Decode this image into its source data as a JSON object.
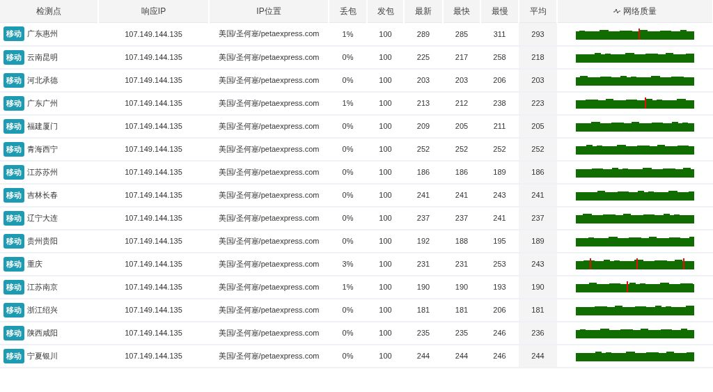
{
  "table": {
    "columns": [
      "检测点",
      "响应IP",
      "IP位置",
      "丢包",
      "发包",
      "最新",
      "最快",
      "最慢",
      "平均",
      "网络质量"
    ],
    "rows": [
      {
        "isp": "移动",
        "node": "广东惠州",
        "ip": "107.149.144.135",
        "location": "美国/圣何塞/petaexpress.com",
        "loss": "1%",
        "sent": "100",
        "latest": "289",
        "fastest": "285",
        "slowest": "311",
        "average": "293"
      },
      {
        "isp": "移动",
        "node": "云南昆明",
        "ip": "107.149.144.135",
        "location": "美国/圣何塞/petaexpress.com",
        "loss": "0%",
        "sent": "100",
        "latest": "225",
        "fastest": "217",
        "slowest": "258",
        "average": "218"
      },
      {
        "isp": "移动",
        "node": "河北承德",
        "ip": "107.149.144.135",
        "location": "美国/圣何塞/petaexpress.com",
        "loss": "0%",
        "sent": "100",
        "latest": "203",
        "fastest": "203",
        "slowest": "206",
        "average": "203"
      },
      {
        "isp": "移动",
        "node": "广东广州",
        "ip": "107.149.144.135",
        "location": "美国/圣何塞/petaexpress.com",
        "loss": "1%",
        "sent": "100",
        "latest": "213",
        "fastest": "212",
        "slowest": "238",
        "average": "223"
      },
      {
        "isp": "移动",
        "node": "福建厦门",
        "ip": "107.149.144.135",
        "location": "美国/圣何塞/petaexpress.com",
        "loss": "0%",
        "sent": "100",
        "latest": "209",
        "fastest": "205",
        "slowest": "211",
        "average": "205"
      },
      {
        "isp": "移动",
        "node": "青海西宁",
        "ip": "107.149.144.135",
        "location": "美国/圣何塞/petaexpress.com",
        "loss": "0%",
        "sent": "100",
        "latest": "252",
        "fastest": "252",
        "slowest": "252",
        "average": "252"
      },
      {
        "isp": "移动",
        "node": "江苏苏州",
        "ip": "107.149.144.135",
        "location": "美国/圣何塞/petaexpress.com",
        "loss": "0%",
        "sent": "100",
        "latest": "186",
        "fastest": "186",
        "slowest": "189",
        "average": "186"
      },
      {
        "isp": "移动",
        "node": "吉林长春",
        "ip": "107.149.144.135",
        "location": "美国/圣何塞/petaexpress.com",
        "loss": "0%",
        "sent": "100",
        "latest": "241",
        "fastest": "241",
        "slowest": "243",
        "average": "241"
      },
      {
        "isp": "移动",
        "node": "辽宁大连",
        "ip": "107.149.144.135",
        "location": "美国/圣何塞/petaexpress.com",
        "loss": "0%",
        "sent": "100",
        "latest": "237",
        "fastest": "237",
        "slowest": "241",
        "average": "237"
      },
      {
        "isp": "移动",
        "node": "贵州贵阳",
        "ip": "107.149.144.135",
        "location": "美国/圣何塞/petaexpress.com",
        "loss": "0%",
        "sent": "100",
        "latest": "192",
        "fastest": "188",
        "slowest": "195",
        "average": "189"
      },
      {
        "isp": "移动",
        "node": "重庆",
        "ip": "107.149.144.135",
        "location": "美国/圣何塞/petaexpress.com",
        "loss": "3%",
        "sent": "100",
        "latest": "231",
        "fastest": "231",
        "slowest": "253",
        "average": "243"
      },
      {
        "isp": "移动",
        "node": "江苏南京",
        "ip": "107.149.144.135",
        "location": "美国/圣何塞/petaexpress.com",
        "loss": "1%",
        "sent": "100",
        "latest": "190",
        "fastest": "190",
        "slowest": "193",
        "average": "190"
      },
      {
        "isp": "移动",
        "node": "浙江绍兴",
        "ip": "107.149.144.135",
        "location": "美国/圣何塞/petaexpress.com",
        "loss": "0%",
        "sent": "100",
        "latest": "181",
        "fastest": "181",
        "slowest": "206",
        "average": "181"
      },
      {
        "isp": "移动",
        "node": "陕西咸阳",
        "ip": "107.149.144.135",
        "location": "美国/圣何塞/petaexpress.com",
        "loss": "0%",
        "sent": "100",
        "latest": "235",
        "fastest": "235",
        "slowest": "246",
        "average": "236"
      },
      {
        "isp": "移动",
        "node": "宁夏银川",
        "ip": "107.149.144.135",
        "location": "美国/圣何塞/petaexpress.com",
        "loss": "0%",
        "sent": "100",
        "latest": "244",
        "fastest": "244",
        "slowest": "246",
        "average": "244"
      }
    ]
  }
}
